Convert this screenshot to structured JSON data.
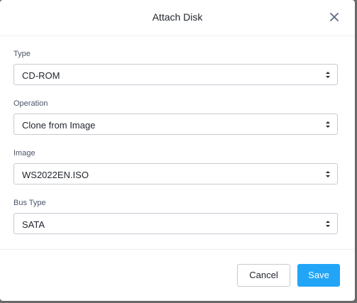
{
  "dialog": {
    "title": "Attach Disk",
    "close_icon": "close-icon"
  },
  "fields": [
    {
      "label": "Type",
      "value": "CD-ROM"
    },
    {
      "label": "Operation",
      "value": "Clone from Image"
    },
    {
      "label": "Image",
      "value": "WS2022EN.ISO"
    },
    {
      "label": "Bus Type",
      "value": "SATA"
    }
  ],
  "footer": {
    "cancel_label": "Cancel",
    "save_label": "Save"
  },
  "colors": {
    "accent": "#22a5f7",
    "close_icon": "#5a6b82"
  }
}
